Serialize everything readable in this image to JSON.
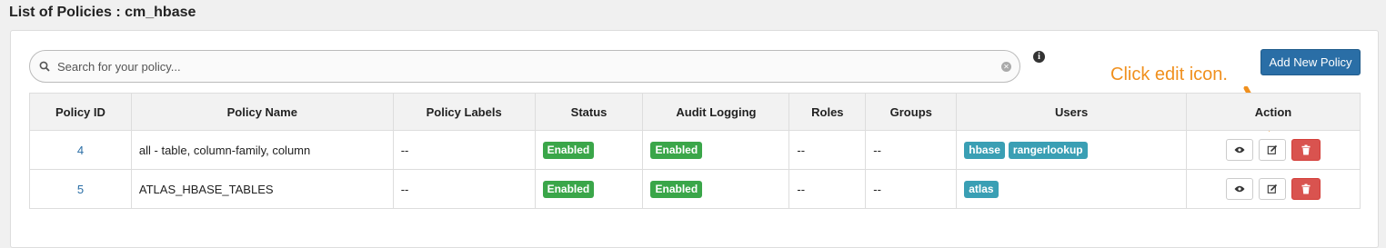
{
  "page": {
    "title": "List of Policies : cm_hbase"
  },
  "search": {
    "placeholder": "Search for your policy..."
  },
  "toolbar": {
    "add_label": "Add New Policy"
  },
  "annotation": {
    "text": "Click edit icon."
  },
  "table": {
    "headers": {
      "id": "Policy ID",
      "name": "Policy Name",
      "labels": "Policy Labels",
      "status": "Status",
      "audit": "Audit Logging",
      "roles": "Roles",
      "groups": "Groups",
      "users": "Users",
      "action": "Action"
    },
    "rows": [
      {
        "id": "4",
        "name": "all - table, column-family, column",
        "labels": "--",
        "status": "Enabled",
        "audit": "Enabled",
        "roles": "--",
        "groups": "--",
        "users": [
          "hbase",
          "rangerlookup"
        ]
      },
      {
        "id": "5",
        "name": "ATLAS_HBASE_TABLES",
        "labels": "--",
        "status": "Enabled",
        "audit": "Enabled",
        "roles": "--",
        "groups": "--",
        "users": [
          "atlas"
        ]
      }
    ]
  },
  "icons": [
    "search-icon",
    "clear-icon",
    "info-icon",
    "eye-icon",
    "edit-icon",
    "trash-icon",
    "arrow-icon"
  ],
  "colors": {
    "primary": "#2a6ea6",
    "enabled": "#3aa649",
    "user_badge": "#3a9fb4",
    "delete": "#d9534f",
    "annotation": "#f0901e"
  }
}
